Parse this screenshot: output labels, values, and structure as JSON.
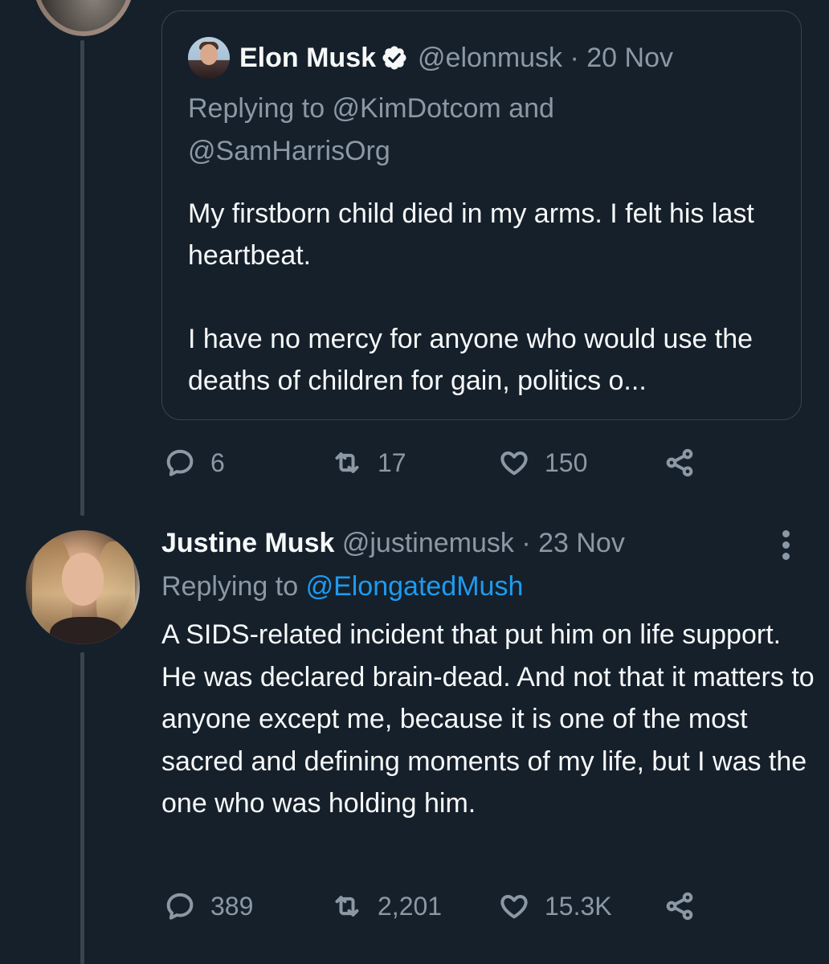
{
  "quoted_tweet": {
    "author_name": "Elon Musk",
    "handle_date": "@elonmusk · 20 Nov",
    "replying_to": "Replying to @KimDotcom and @SamHarrisOrg",
    "text_line1": "My firstborn child died in my arms. I felt his last heartbeat.",
    "text_line2": "I have no mercy for anyone who would use the deaths of children for gain, politics o..."
  },
  "quoted_actions": {
    "replies": "6",
    "retweets": "17",
    "likes": "150"
  },
  "reply_tweet": {
    "author_name": "Justine Musk",
    "handle_date": "@justinemusk · 23 Nov",
    "replying_prefix": "Replying to",
    "replying_handle": "@ElongatedMush",
    "text": "A SIDS-related incident that put him on life support. He was declared brain-dead. And not that it matters to anyone except me, because it is one of the most sacred and defining moments of my life, but I was the one who was holding him."
  },
  "reply_actions": {
    "replies": "389",
    "retweets": "2,201",
    "likes": "15.3K"
  },
  "colors": {
    "background": "#15202b",
    "text_primary": "#f7f9f9",
    "text_secondary": "#8b98a5",
    "link": "#1d9bf0",
    "border": "#38444d"
  }
}
